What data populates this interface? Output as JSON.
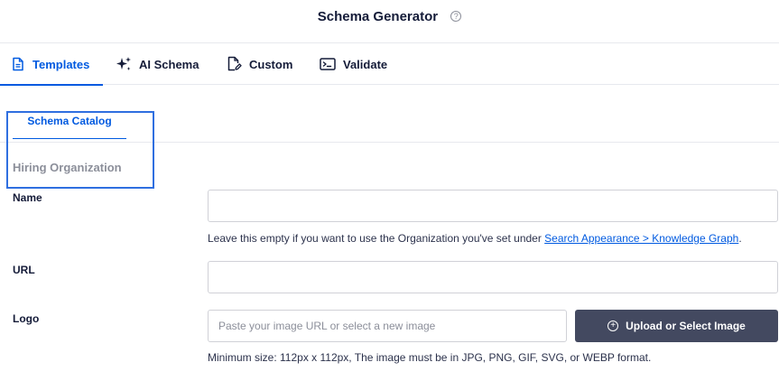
{
  "header": {
    "title": "Schema Generator"
  },
  "tabs": [
    {
      "label": "Templates",
      "icon": "document-icon",
      "active": true
    },
    {
      "label": "AI Schema",
      "icon": "sparkles-icon",
      "active": false
    },
    {
      "label": "Custom",
      "icon": "edit-document-icon",
      "active": false
    },
    {
      "label": "Validate",
      "icon": "terminal-icon",
      "active": false
    }
  ],
  "catalog": {
    "tab_label": "Schema Catalog"
  },
  "section": {
    "heading": "Hiring Organization"
  },
  "form": {
    "name": {
      "label": "Name",
      "value": "",
      "help_prefix": "Leave this empty if you want to use the Organization you've set under ",
      "help_link": "Search Appearance > Knowledge Graph",
      "help_suffix": "."
    },
    "url": {
      "label": "URL",
      "value": ""
    },
    "logo": {
      "label": "Logo",
      "placeholder": "Paste your image URL or select a new image",
      "button_label": "Upload or Select Image",
      "help": "Minimum size: 112px x 112px, The image must be in JPG, PNG, GIF, SVG, or WEBP format."
    }
  },
  "colors": {
    "accent": "#005ae0",
    "button_bg": "#434960",
    "highlight": "#2f6fe0"
  }
}
